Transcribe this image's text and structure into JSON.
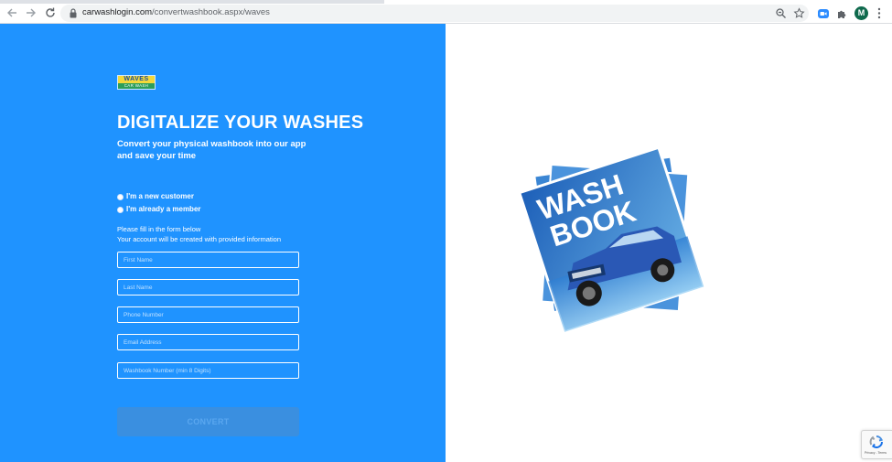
{
  "browser": {
    "url_domain": "carwashlogin.com",
    "url_path": "/convertwashbook.aspx/waves",
    "avatar_letter": "M"
  },
  "logo": {
    "line1": "WAVES",
    "line2": "CAR WASH"
  },
  "hero": {
    "title": "DIGITALIZE YOUR WASHES",
    "subtitle_line1": "Convert your physical washbook into our app",
    "subtitle_line2": "and save your time"
  },
  "customer_type": {
    "options": [
      {
        "label": "I'm a new customer",
        "selected": false
      },
      {
        "label": "I'm already a member",
        "selected": false
      }
    ]
  },
  "form": {
    "instruction_line1": "Please fill in the form below",
    "instruction_line2": "Your account will be created with provided information",
    "fields": [
      {
        "placeholder": "First Name",
        "value": ""
      },
      {
        "placeholder": "Last Name",
        "value": ""
      },
      {
        "placeholder": "Phone Number",
        "value": ""
      },
      {
        "placeholder": "Email Address",
        "value": ""
      },
      {
        "placeholder": "Washbook Number (min 8 Digits)",
        "value": ""
      }
    ],
    "submit_label": "CONVERT"
  },
  "product_image": {
    "title_word1": "WASH",
    "title_word2": "BOOK"
  },
  "recaptcha": {
    "footer": "Privacy - Terms"
  },
  "colors": {
    "panel_blue": "#1f93ff",
    "button_blue": "#3a8fe0",
    "book_blue": "#1d5fb8"
  },
  "icons": [
    "back-arrow-icon",
    "forward-arrow-icon",
    "reload-icon",
    "lock-icon",
    "zoom-icon",
    "star-icon",
    "zoom-ext-icon",
    "extensions-puzzle-icon",
    "menu-dots-icon",
    "recaptcha-icon"
  ]
}
